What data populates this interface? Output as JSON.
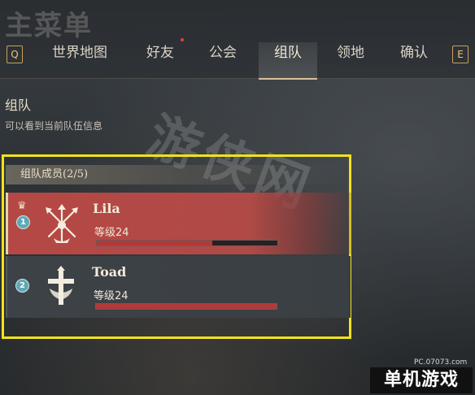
{
  "header": {
    "menu_title": "主菜单",
    "key_left": "Q",
    "key_right": "E",
    "tabs": [
      {
        "label": "世界地图",
        "active": false,
        "notify": false
      },
      {
        "label": "好友",
        "active": false,
        "notify": true
      },
      {
        "label": "公会",
        "active": false,
        "notify": false
      },
      {
        "label": "组队",
        "active": true,
        "notify": false
      },
      {
        "label": "领地",
        "active": false,
        "notify": false
      },
      {
        "label": "确认",
        "active": false,
        "notify": false
      }
    ]
  },
  "section": {
    "title": "组队",
    "description": "可以看到当前队伍信息"
  },
  "party": {
    "header": "组队成员(2/5)",
    "members": [
      {
        "index": "1",
        "name": "Lila",
        "level": "等级24",
        "leader": true,
        "crown_icon": "crown-icon",
        "emblem_icon": "crossed-swords-emblem-icon",
        "hp": 0.64
      },
      {
        "index": "2",
        "name": "Toad",
        "level": "等级24",
        "leader": false,
        "emblem_icon": "cross-emblem-icon",
        "hp": 1.0
      }
    ]
  },
  "watermark": {
    "site": "PC.07073.com",
    "logo": "单机游戏",
    "center": "游侠网"
  },
  "colors": {
    "highlight_box": "#f2e21a",
    "leader_row": "#b54845",
    "hp_bar": "#b2393a",
    "key_accent": "#c9a25a",
    "badge": "#5ea9b5"
  }
}
